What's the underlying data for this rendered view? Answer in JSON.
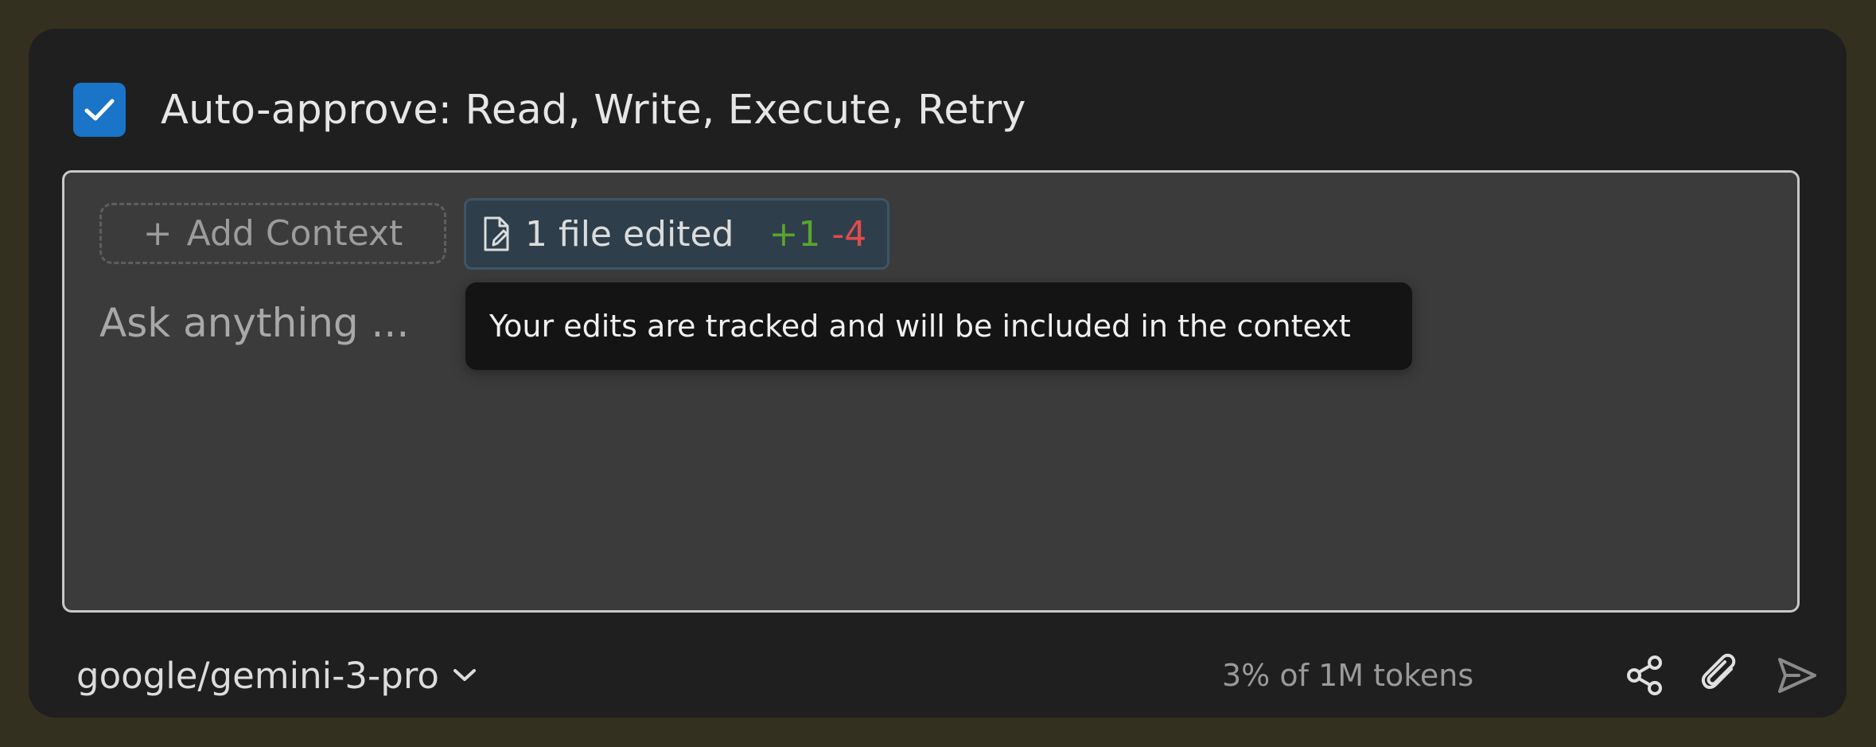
{
  "auto_approve": {
    "checked": true,
    "label": "Auto-approve: Read, Write, Execute, Retry"
  },
  "input": {
    "add_context": {
      "icon": "plus-icon",
      "label": "Add Context"
    },
    "files_chip": {
      "icon": "file-edit-icon",
      "label": "1 file edited",
      "added": "+1",
      "removed": "-4"
    },
    "placeholder": "Ask anything ...",
    "tooltip": "Your edits are tracked and will be included in the context"
  },
  "footer": {
    "model": "google/gemini-3-pro",
    "model_icon": "chevron-down-icon",
    "token_usage": "3% of 1M tokens",
    "actions": [
      {
        "icon": "share-icon"
      },
      {
        "icon": "paperclip-icon"
      },
      {
        "icon": "send-icon"
      }
    ]
  },
  "colors": {
    "checkbox": "#1a74c7",
    "added": "#59a52d",
    "removed": "#e14b4b"
  }
}
